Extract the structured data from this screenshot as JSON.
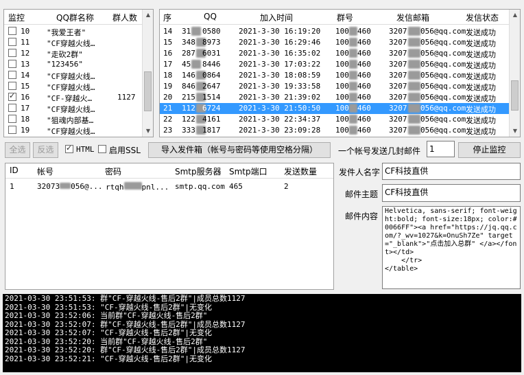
{
  "groups": {
    "headers": [
      "监控",
      "QQ群名称",
      "群人数"
    ],
    "rows": [
      {
        "checked": false,
        "id": "10",
        "name": "\"我爱王者\"",
        "count": ""
      },
      {
        "checked": false,
        "id": "11",
        "name": "\"CF穿越火线…",
        "count": ""
      },
      {
        "checked": false,
        "id": "12",
        "name": "\"走砍2群\"",
        "count": ""
      },
      {
        "checked": false,
        "id": "13",
        "name": "\"123456\"",
        "count": ""
      },
      {
        "checked": false,
        "id": "14",
        "name": "\"CF穿越火线…",
        "count": ""
      },
      {
        "checked": false,
        "id": "15",
        "name": "\"CF穿越火线…",
        "count": ""
      },
      {
        "checked": true,
        "id": "16",
        "name": "\"CF-穿越火…",
        "count": "1127"
      },
      {
        "checked": false,
        "id": "17",
        "name": "\"CF穿越火线…",
        "count": ""
      },
      {
        "checked": false,
        "id": "18",
        "name": "\"狙魂内部基…",
        "count": ""
      },
      {
        "checked": false,
        "id": "19",
        "name": "\"CF穿越火线…",
        "count": ""
      }
    ]
  },
  "sendlog": {
    "headers": [
      "序",
      "QQ",
      "加入时间",
      "群号",
      "发信邮箱",
      "发信状态"
    ],
    "rows": [
      {
        "seq": "14",
        "qq_a": "31",
        "qq_b": "0580",
        "time": "2021-3-30 16:19:20",
        "grp_a": "100",
        "grp_b": "460",
        "mail_a": "3207",
        "mail_b": "056@qq.com",
        "status": "发送成功"
      },
      {
        "seq": "15",
        "qq_a": "348",
        "qq_b": "8973",
        "time": "2021-3-30 16:29:46",
        "grp_a": "100",
        "grp_b": "460",
        "mail_a": "3207",
        "mail_b": "056@qq.com",
        "status": "发送成功"
      },
      {
        "seq": "16",
        "qq_a": "287",
        "qq_b": "6031",
        "time": "2021-3-30 16:35:02",
        "grp_a": "100",
        "grp_b": "460",
        "mail_a": "3207",
        "mail_b": "056@qq.com",
        "status": "发送成功"
      },
      {
        "seq": "17",
        "qq_a": "45",
        "qq_b": "8446",
        "time": "2021-3-30 17:03:22",
        "grp_a": "100",
        "grp_b": "460",
        "mail_a": "3207",
        "mail_b": "056@qq.com",
        "status": "发送成功"
      },
      {
        "seq": "18",
        "qq_a": "146",
        "qq_b": "0864",
        "time": "2021-3-30 18:08:59",
        "grp_a": "100",
        "grp_b": "460",
        "mail_a": "3207",
        "mail_b": "056@qq.com",
        "status": "发送成功"
      },
      {
        "seq": "19",
        "qq_a": "846",
        "qq_b": "2647",
        "time": "2021-3-30 19:33:58",
        "grp_a": "100",
        "grp_b": "460",
        "mail_a": "3207",
        "mail_b": "056@qq.com",
        "status": "发送成功"
      },
      {
        "seq": "20",
        "qq_a": "215",
        "qq_b": "1514",
        "time": "2021-3-30 21:39:02",
        "grp_a": "100",
        "grp_b": "460",
        "mail_a": "3207",
        "mail_b": "056@qq.com",
        "status": "发送成功"
      },
      {
        "seq": "21",
        "qq_a": "112",
        "qq_b": "6724",
        "time": "2021-3-30 21:50:50",
        "grp_a": "100",
        "grp_b": "460",
        "mail_a": "3207",
        "mail_b": "056@qq.com",
        "status": "发送成功"
      },
      {
        "seq": "22",
        "qq_a": "122",
        "qq_b": "4161",
        "time": "2021-3-30 22:34:37",
        "grp_a": "100",
        "grp_b": "460",
        "mail_a": "3207",
        "mail_b": "056@qq.com",
        "status": "发送成功"
      },
      {
        "seq": "23",
        "qq_a": "333",
        "qq_b": "1817",
        "time": "2021-3-30 23:09:28",
        "grp_a": "100",
        "grp_b": "460",
        "mail_a": "3207",
        "mail_b": "056@qq.com",
        "status": "发送成功"
      }
    ],
    "selected_index": 7
  },
  "toolbar": {
    "select_all": "全选",
    "invert": "反选",
    "html_label": "HTML",
    "html_checked": true,
    "ssl_label": "启用SSL",
    "ssl_checked": false,
    "import_button": "导入发件箱（帐号与密码等使用空格分隔）",
    "per_account_label": "一个帐号发送几封邮件",
    "per_account_value": "1",
    "stop_button": "停止监控"
  },
  "accounts": {
    "headers": [
      "ID",
      "帐号",
      "密码",
      "Smtp服务器",
      "Smtp端口",
      "发送数量"
    ],
    "rows": [
      {
        "id": "1",
        "account_a": "32073",
        "account_b": "056@...",
        "password_a": "rtqh",
        "password_b": "pnl...",
        "server": "smtp.qq.com",
        "port": "465",
        "count": "2"
      }
    ]
  },
  "mail": {
    "sender_label": "发件人名字",
    "sender_value": "CF科技直供",
    "subject_label": "邮件主题",
    "subject_value": "CF科技直供",
    "content_label": "邮件内容",
    "content_value": "Helvetica, sans-serif; font-weight:bold; font-size:18px; color:#0066FF\"><a href=\"https://jq.qq.com/?_wv=1027&k=OnuSh7Ze\" target=\"_blank\">\"点击加入总群\" </a></font></td>\n    </tr>\n</table>"
  },
  "log": {
    "lines": [
      "2021-03-30 23:51:53: 群\"CF-穿越火线-售后2群\"|成员总数1127",
      "2021-03-30 23:51:53: \"CF-穿越火线-售后2群\"|无变化",
      "2021-03-30 23:52:06: 当前群\"CF-穿越火线-售后2群\"",
      "2021-03-30 23:52:07: 群\"CF-穿越火线-售后2群\"|成员总数1127",
      "2021-03-30 23:52:07: \"CF-穿越火线-售后2群\"|无变化",
      "2021-03-30 23:52:20: 当前群\"CF-穿越火线-售后2群\"",
      "2021-03-30 23:52:20: 群\"CF-穿越火线-售后2群\"|成员总数1127",
      "2021-03-30 23:52:21: \"CF-穿越火线-售后2群\"|无变化"
    ]
  }
}
